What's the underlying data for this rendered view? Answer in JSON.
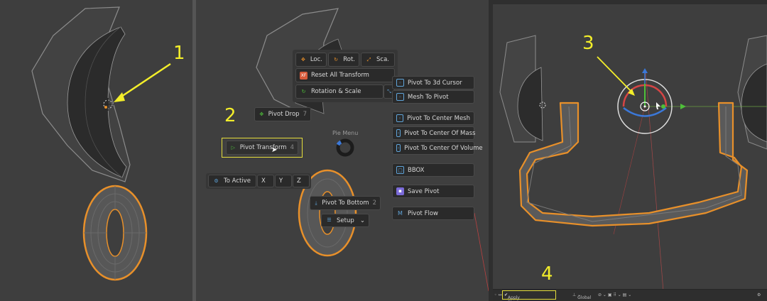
{
  "annotations": {
    "n1": "1",
    "n2": "2",
    "n3": "3",
    "n4": "4"
  },
  "pie_menu": {
    "loc": "Loc.",
    "rot": "Rot.",
    "sca": "Sca.",
    "reset_all": "Reset All Transform",
    "rotation_scale": "Rotation & Scale",
    "pivot_drop": "Pivot Drop",
    "pivot_drop_key": "7",
    "pivot_transform": "Pivot Transform",
    "pivot_transform_key": "4",
    "pie_menu_label": "Pie Menu",
    "to_active": "To Active",
    "x": "X",
    "y": "Y",
    "z": "Z",
    "pivot_to_bottom": "Pivot To Bottom",
    "pivot_to_bottom_key": "2",
    "setup": "Setup"
  },
  "right_menu": {
    "items": [
      "Pivot To 3d Cursor",
      "Mesh To Pivot",
      "Pivot To Center Mesh",
      "Pivot To Center Of Mass",
      "Pivot To Center Of Volume",
      "BBOX",
      "Save Pivot",
      "Pivot Flow"
    ]
  },
  "status_bar": {
    "apply": "Apply Pivot Transform",
    "orientation": "Global"
  },
  "colors": {
    "accent_yellow": "#f3ee2a",
    "selection_orange": "#e8902a",
    "gizmo_red": "#d64545",
    "gizmo_blue": "#3b78d8",
    "gizmo_green": "#4fbf3a"
  }
}
